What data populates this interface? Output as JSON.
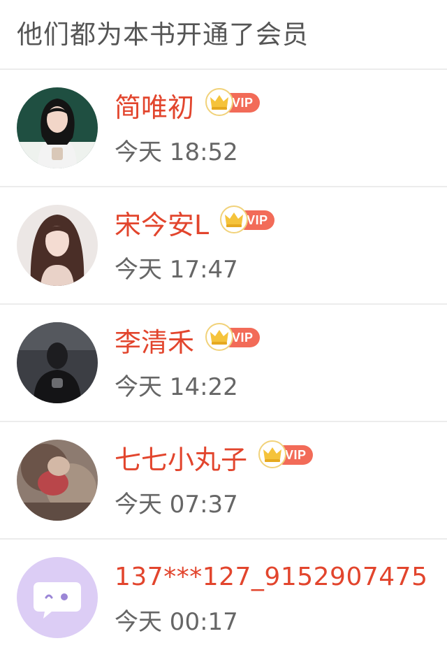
{
  "header": {
    "title": "他们都为本书开通了会员"
  },
  "members": [
    {
      "name": "简唯初",
      "badge": "VIP",
      "time": "今天 18:52",
      "avatar": "photo-woman-green-bg-icon"
    },
    {
      "name": "宋今安L",
      "badge": "VIP",
      "time": "今天 17:47",
      "avatar": "photo-woman-portrait-icon"
    },
    {
      "name": "李清禾",
      "badge": "VIP",
      "time": "今天 14:22",
      "avatar": "photo-dark-figure-icon"
    },
    {
      "name": "七七小丸子",
      "badge": "VIP",
      "time": "今天 07:37",
      "avatar": "photo-blurry-person-icon"
    },
    {
      "name": "137***127_9152907475",
      "time": "今天 00:17",
      "avatar": "default-chat-bubble-icon"
    }
  ],
  "colors": {
    "name": "#e2452d",
    "vip_pill": "#f26b58",
    "crown": "#f5c33b",
    "divider": "#ececec",
    "default_avatar_bg": "#dccdf5"
  }
}
